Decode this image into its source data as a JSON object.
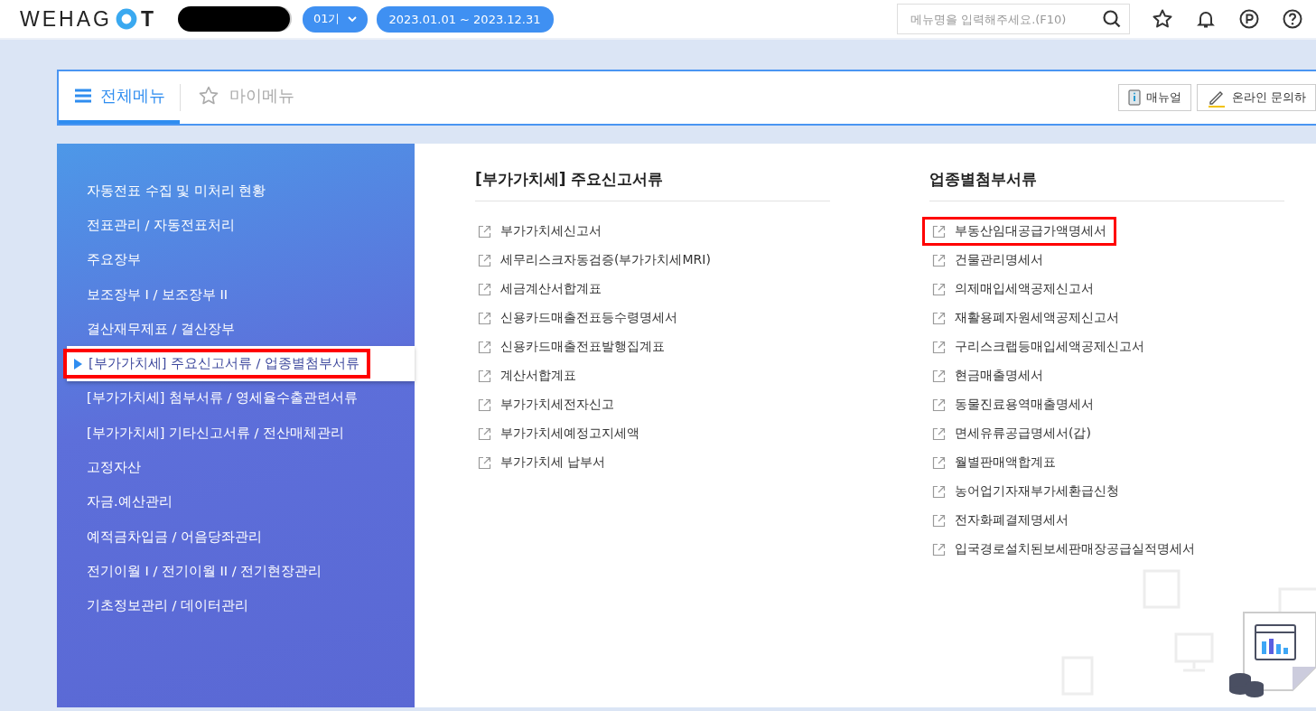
{
  "header": {
    "logo": {
      "left": "WEHAG",
      "right": "T"
    },
    "period": "01기",
    "date_range": "2023.01.01 ~ 2023.12.31",
    "search": {
      "placeholder": "메뉴명을 입력해주세요.(F10)"
    }
  },
  "tabs": [
    {
      "label": "전체메뉴",
      "selected": true
    },
    {
      "label": "마이메뉴",
      "selected": false
    }
  ],
  "tool_buttons": [
    {
      "kind": "manual",
      "label": "매뉴얼"
    },
    {
      "kind": "inquiry",
      "label": "온라인 문의하"
    }
  ],
  "sidebar": {
    "items": [
      {
        "label": "자동전표 수집 및 미처리 현황",
        "selected": false,
        "highlighted": false
      },
      {
        "label": "전표관리 / 자동전표처리",
        "selected": false,
        "highlighted": false
      },
      {
        "label": "주요장부",
        "selected": false,
        "highlighted": false
      },
      {
        "label": "보조장부 I / 보조장부 II",
        "selected": false,
        "highlighted": false
      },
      {
        "label": "결산재무제표 / 결산장부",
        "selected": false,
        "highlighted": false
      },
      {
        "label": "[부가가치세] 주요신고서류 / 업종별첨부서류",
        "selected": true,
        "highlighted": true
      },
      {
        "label": "[부가가치세] 첨부서류 / 영세율수출관련서류",
        "selected": false,
        "highlighted": false
      },
      {
        "label": "[부가가치세] 기타신고서류 / 전산매체관리",
        "selected": false,
        "highlighted": false
      },
      {
        "label": "고정자산",
        "selected": false,
        "highlighted": false
      },
      {
        "label": "자금.예산관리",
        "selected": false,
        "highlighted": false
      },
      {
        "label": "예적금차입금 / 어음당좌관리",
        "selected": false,
        "highlighted": false
      },
      {
        "label": "전기이월 Ⅰ / 전기이월 II / 전기현장관리",
        "selected": false,
        "highlighted": false
      },
      {
        "label": "기초정보관리 / 데이터관리",
        "selected": false,
        "highlighted": false
      }
    ]
  },
  "sections": [
    {
      "title": "[부가가치세] 주요신고서류",
      "items": [
        {
          "label": "부가가치세신고서",
          "highlighted": false
        },
        {
          "label": "세무리스크자동검증(부가가치세MRI)",
          "highlighted": false
        },
        {
          "label": "세금계산서합계표",
          "highlighted": false
        },
        {
          "label": "신용카드매출전표등수령명세서",
          "highlighted": false
        },
        {
          "label": "신용카드매출전표발행집계표",
          "highlighted": false
        },
        {
          "label": "계산서합계표",
          "highlighted": false
        },
        {
          "label": "부가가치세전자신고",
          "highlighted": false
        },
        {
          "label": "부가가치세예정고지세액",
          "highlighted": false
        },
        {
          "label": "부가가치세 납부서",
          "highlighted": false
        }
      ]
    },
    {
      "title": "업종별첨부서류",
      "items": [
        {
          "label": "부동산임대공급가액명세서",
          "highlighted": true
        },
        {
          "label": "건물관리명세서",
          "highlighted": false
        },
        {
          "label": "의제매입세액공제신고서",
          "highlighted": false
        },
        {
          "label": "재활용폐자원세액공제신고서",
          "highlighted": false
        },
        {
          "label": "구리스크랩등매입세액공제신고서",
          "highlighted": false
        },
        {
          "label": "현금매출명세서",
          "highlighted": false
        },
        {
          "label": "동물진료용역매출명세서",
          "highlighted": false
        },
        {
          "label": "면세유류공급명세서(갑)",
          "highlighted": false
        },
        {
          "label": "월별판매액합계표",
          "highlighted": false
        },
        {
          "label": "농어업기자재부가세환급신청",
          "highlighted": false
        },
        {
          "label": "전자화폐결제명세서",
          "highlighted": false
        },
        {
          "label": "입국경로설치된보세판매장공급실적명세서",
          "highlighted": false
        }
      ]
    }
  ]
}
